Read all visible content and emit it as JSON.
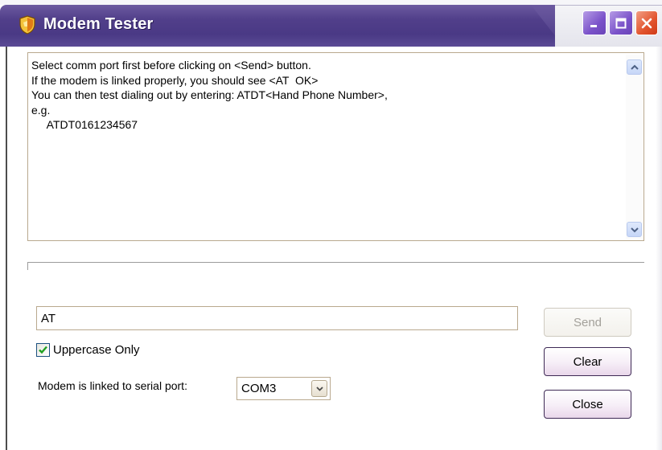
{
  "window": {
    "title": "Modem Tester",
    "icons": {
      "app": "shield-icon",
      "minimize": "minimize-icon",
      "maximize": "maximize-icon",
      "close": "close-icon"
    },
    "colors": {
      "titlebar": "#4a3985",
      "close": "#e2542d",
      "control": "#7a52c9"
    }
  },
  "output": {
    "text": "Select comm port first before clicking on <Send> button.\nIf the modem is linked properly, you should see <AT  OK>\nYou can then test dialing out by entering: ATDT<Hand Phone Number>,\ne.g.\n     ATDT0161234567"
  },
  "command": {
    "value": "AT"
  },
  "buttons": {
    "send": "Send",
    "clear": "Clear",
    "close": "Close"
  },
  "options": {
    "uppercase_label": "Uppercase Only",
    "uppercase_checked": true
  },
  "port": {
    "label": "Modem is linked to serial port:",
    "selected": "COM3"
  }
}
